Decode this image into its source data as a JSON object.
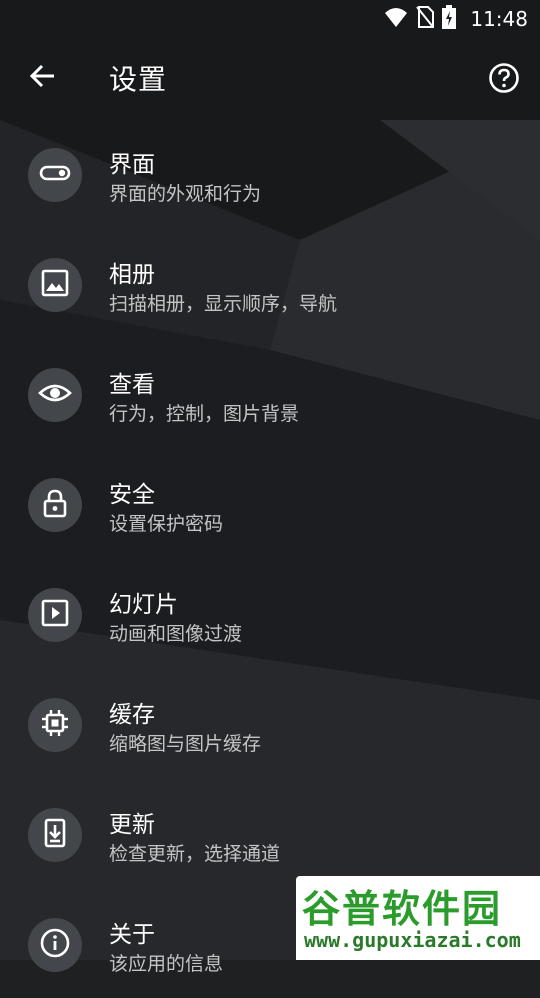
{
  "status_bar": {
    "time": "11:48",
    "icons": [
      "wifi-icon",
      "no-sim-icon",
      "battery-charging-icon"
    ]
  },
  "app_bar": {
    "title": "设置",
    "back_icon": "arrow-left-icon",
    "help_icon": "help-circle-icon"
  },
  "settings": [
    {
      "icon": "toggle-icon",
      "title": "界面",
      "subtitle": "界面的外观和行为"
    },
    {
      "icon": "image-icon",
      "title": "相册",
      "subtitle": "扫描相册，显示顺序，导航"
    },
    {
      "icon": "eye-icon",
      "title": "查看",
      "subtitle": "行为，控制，图片背景"
    },
    {
      "icon": "lock-icon",
      "title": "安全",
      "subtitle": "设置保护密码"
    },
    {
      "icon": "slideshow-icon",
      "title": "幻灯片",
      "subtitle": "动画和图像过渡"
    },
    {
      "icon": "chip-icon",
      "title": "缓存",
      "subtitle": "缩略图与图片缓存"
    },
    {
      "icon": "download-icon",
      "title": "更新",
      "subtitle": "检查更新，选择通道"
    },
    {
      "icon": "info-icon",
      "title": "关于",
      "subtitle": "该应用的信息"
    }
  ],
  "watermark": {
    "title": "谷普软件园",
    "url": "www.gupuxiazai.com"
  },
  "colors": {
    "background": "#1f2022",
    "icon_circle": "#43464a",
    "subtitle": "#c2c4c6",
    "watermark_green": "#2b9b2b"
  }
}
